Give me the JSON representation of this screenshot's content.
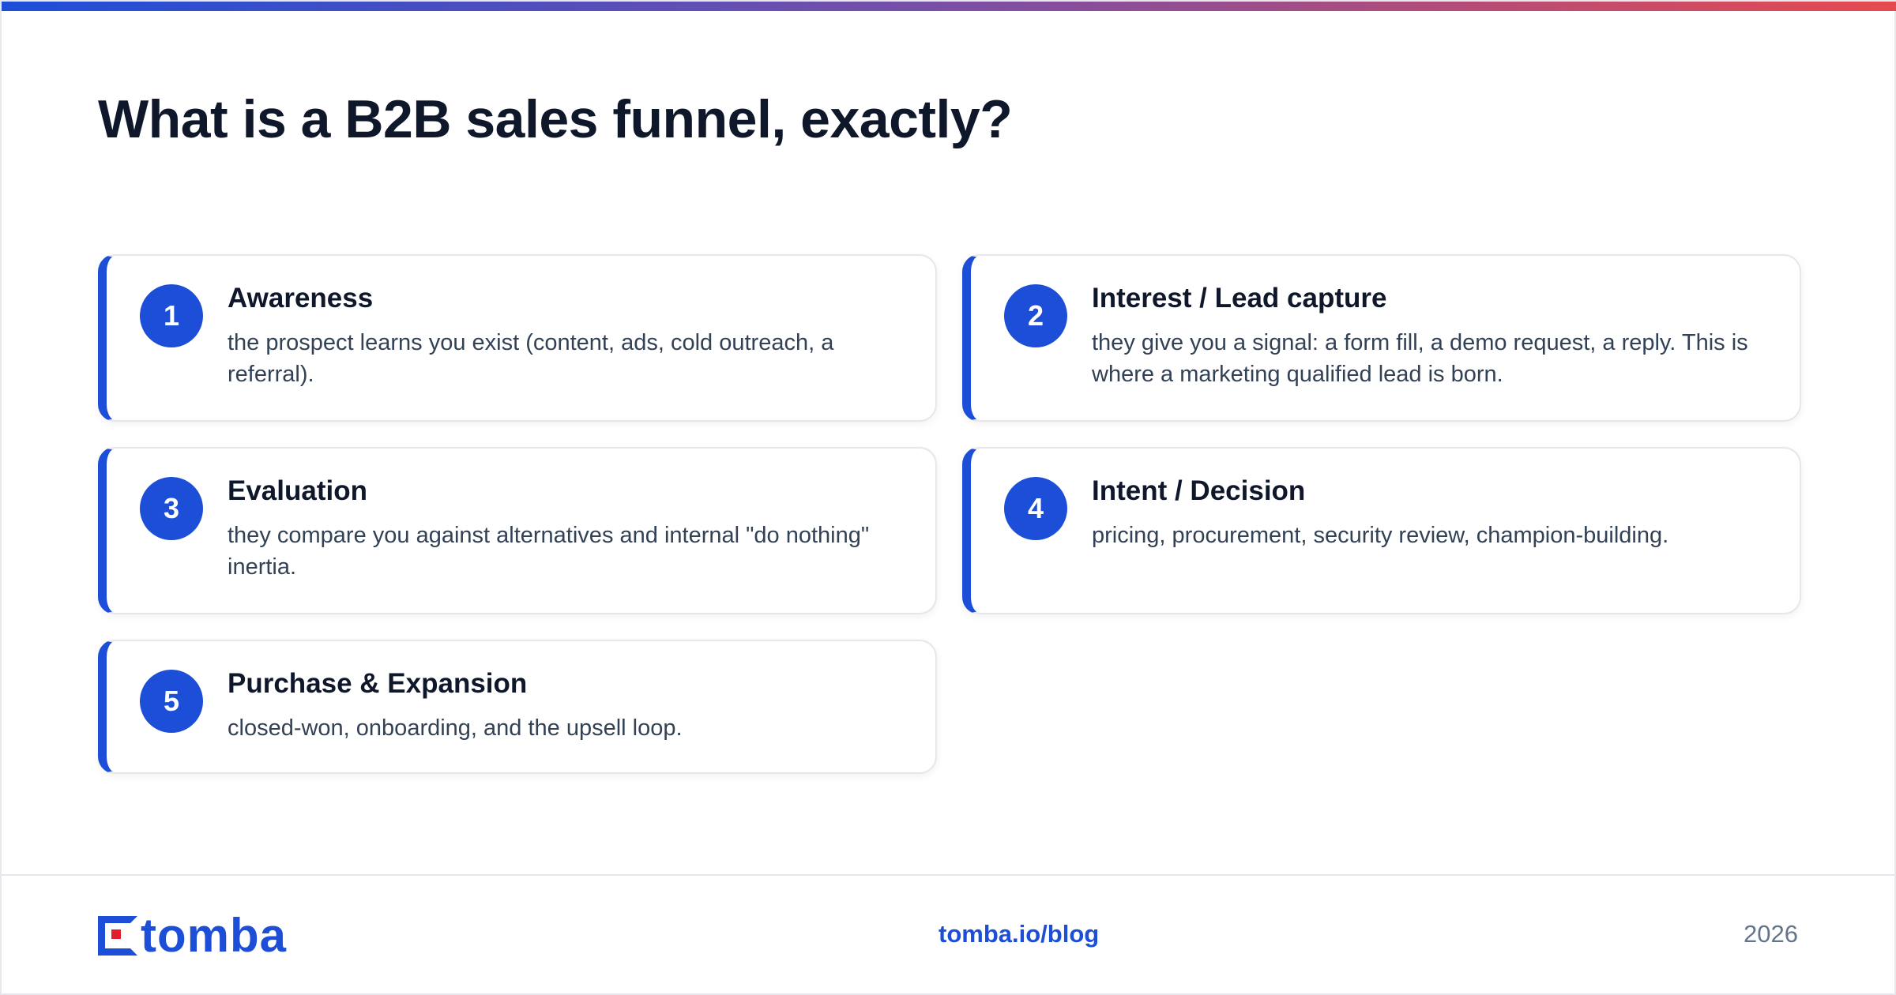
{
  "header": {
    "title": "What is a B2B sales funnel, exactly?"
  },
  "cards": [
    {
      "number": "1",
      "title": "Awareness",
      "description": "the prospect learns you exist (content, ads, cold outreach, a referral)."
    },
    {
      "number": "2",
      "title": "Interest / Lead capture",
      "description": "they give you a signal: a form fill, a demo request, a reply. This is where a marketing qualified lead is born."
    },
    {
      "number": "3",
      "title": "Evaluation",
      "description": "they compare you against alternatives and internal \"do nothing\" inertia."
    },
    {
      "number": "4",
      "title": "Intent / Decision",
      "description": "pricing, procurement, security review, champion-building."
    },
    {
      "number": "5",
      "title": "Purchase & Expansion",
      "description": "closed-won, onboarding, and the upsell loop."
    }
  ],
  "footer": {
    "logo_text": "tomba",
    "link": "tomba.io/blog",
    "year": "2026"
  },
  "colors": {
    "accent": "#1d4ed8",
    "logo_dot": "#e11d2e",
    "gradient_start": "#1d4ed8",
    "gradient_end": "#e64a4f"
  },
  "icons": {
    "logo": "tomba-logo-icon"
  }
}
